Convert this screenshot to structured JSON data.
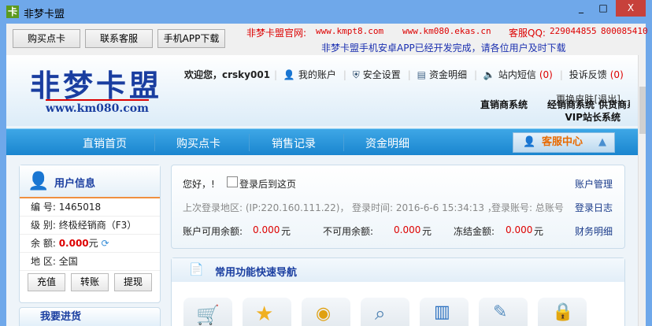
{
  "window": {
    "title": "非梦卡盟",
    "app_icon": "卡",
    "minimize": "_",
    "maximize": "□",
    "close": "X"
  },
  "toolbar": {
    "buttons": [
      "购买点卡",
      "联系客服",
      "手机APP下载"
    ],
    "site_label": "非梦卡盟官网:",
    "site1": "www.kmpt8.com",
    "site2": "www.km080.ekas.cn",
    "qq_label": "客服QQ:",
    "qq1": "229044855",
    "qq2": "800085410",
    "notice": "非梦卡盟手机安卓APP已经开发完成，请各位用户及时下载"
  },
  "header": {
    "logo": "非梦卡盟",
    "logo_url": "www.km080.com",
    "welcome": "欢迎您，crsky001",
    "links": [
      "我的账户",
      "安全设置",
      "资金明细",
      "站内短信",
      "投诉反馈"
    ],
    "msg_count": "(0)",
    "complaint_count": "(0)",
    "skin": "更换皮肤",
    "logout": "[退出]",
    "systems": [
      "直销商系统",
      "经销商系统",
      "供货商系统",
      "VIP站长系统"
    ]
  },
  "nav": {
    "items": [
      "直销首页",
      "购买点卡",
      "销售记录",
      "资金明细"
    ],
    "service": "客服中心"
  },
  "user": {
    "title": "用户信息",
    "rows": [
      {
        "label": "编 号:",
        "value": "1465018"
      },
      {
        "label": "级 别:",
        "value": "终极经销商（F3）"
      },
      {
        "label": "余 额:",
        "value": "0.000",
        "unit": "元"
      },
      {
        "label": "地 区:",
        "value": "全国"
      }
    ],
    "buttons": [
      "充值",
      "转账",
      "提现"
    ],
    "next_panel": "我要进货"
  },
  "account": {
    "greeting": "您好，!",
    "checkbox_label": "登录后到这页",
    "last_login": "上次登录地区: (IP:220.160.111.22)，",
    "login_time": "登录时间: 2016-6-6 15:34:13 ，",
    "login_account": "登录账号: 总账号",
    "available_label": "账户可用余额:",
    "available": "0.000",
    "unavailable_label": "不可用余额:",
    "unavailable": "0.000",
    "frozen_label": "冻结金额:",
    "frozen": "0.000",
    "unit": "元",
    "links": [
      "账户管理",
      "登录日志",
      "财务明细"
    ]
  },
  "quicknav": {
    "title": "常用功能快速导航",
    "icons": [
      "cart-icon",
      "star-icon",
      "coins-icon",
      "search-icon",
      "chart-icon",
      "document-icon",
      "lock-icon"
    ]
  }
}
